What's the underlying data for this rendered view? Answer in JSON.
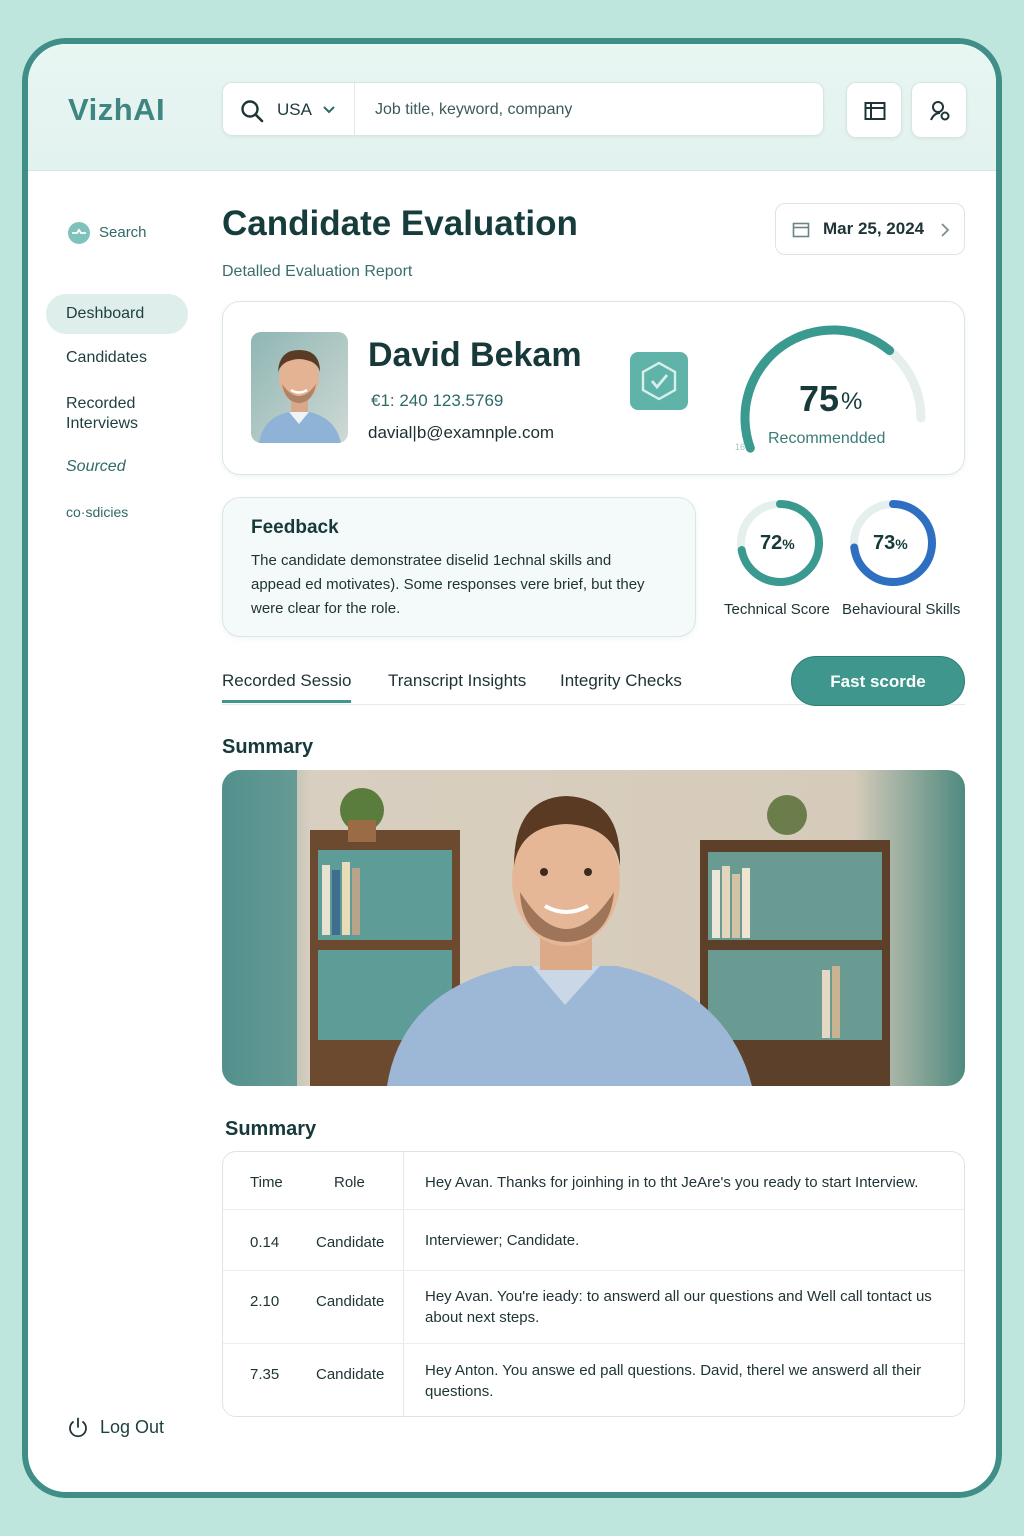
{
  "app": {
    "logo": "VizhAI"
  },
  "search": {
    "country": "USA",
    "placeholder": "Job title, keyword, company"
  },
  "toolbar": {
    "icons": [
      "calendar-icon",
      "user-icon"
    ]
  },
  "sidebar": {
    "search_label": "Search",
    "items": [
      {
        "label": "Deshboard",
        "active": true
      },
      {
        "label": "Candidates"
      },
      {
        "label": "Recorded\nInterviews"
      },
      {
        "label": "Sourced"
      },
      {
        "label": "co·sdicies"
      }
    ],
    "logout": "Log Out"
  },
  "page": {
    "title": "Candidate Evaluation",
    "subtitle": "Detalled Evaluation Report",
    "date": "Mar 25, 2024"
  },
  "candidate": {
    "name": "David Bekam",
    "phone": "€1: 240 123.5769",
    "email": "davial|b@examnple.com",
    "score": {
      "value": "75",
      "unit": "%",
      "label": "Recommendded",
      "gauge_min": "16",
      "fraction": 0.75
    }
  },
  "feedback": {
    "title": "Feedback",
    "text": "The candidate demonstratee diselid 1echnal skills and appead ed motivates). Some responses vere brief, but they were clear for the role."
  },
  "scores": [
    {
      "value": "72",
      "unit": "%",
      "label": "Technical Score",
      "fraction": 0.72,
      "color": "#3a9a90"
    },
    {
      "value": "73",
      "unit": "%",
      "label": "Behavioural Skills",
      "fraction": 0.73,
      "color": "#2f6fc2"
    }
  ],
  "tabs": [
    {
      "label": "Recorded Sessio",
      "active": true
    },
    {
      "label": "Transcript Insights"
    },
    {
      "label": "Integrity Checks"
    }
  ],
  "action": {
    "label": "Fast scorde"
  },
  "summary": {
    "title": "Summary"
  },
  "transcript": {
    "title": "Summary",
    "headers": {
      "time": "Time",
      "role": "Role",
      "text": "Hey Avan. Thanks for joinhing in to tht JeAre's you ready to start Interview."
    },
    "rows": [
      {
        "time": "0.14",
        "role": "Candidate",
        "text": "Interviewer; Candidate."
      },
      {
        "time": "2.10",
        "role": "Candidate",
        "text": "Hey Avan. You're ieady: to answerd all our questions and Well call tontact us about next steps."
      },
      {
        "time": "7.35",
        "role": "Candidate",
        "text": "Hey Anton. You answe ed pall questions. David, therel we answerd all their questions."
      }
    ]
  },
  "colors": {
    "accent": "#3f968d",
    "frame": "#3f8f88",
    "background": "#bfe6dc"
  }
}
